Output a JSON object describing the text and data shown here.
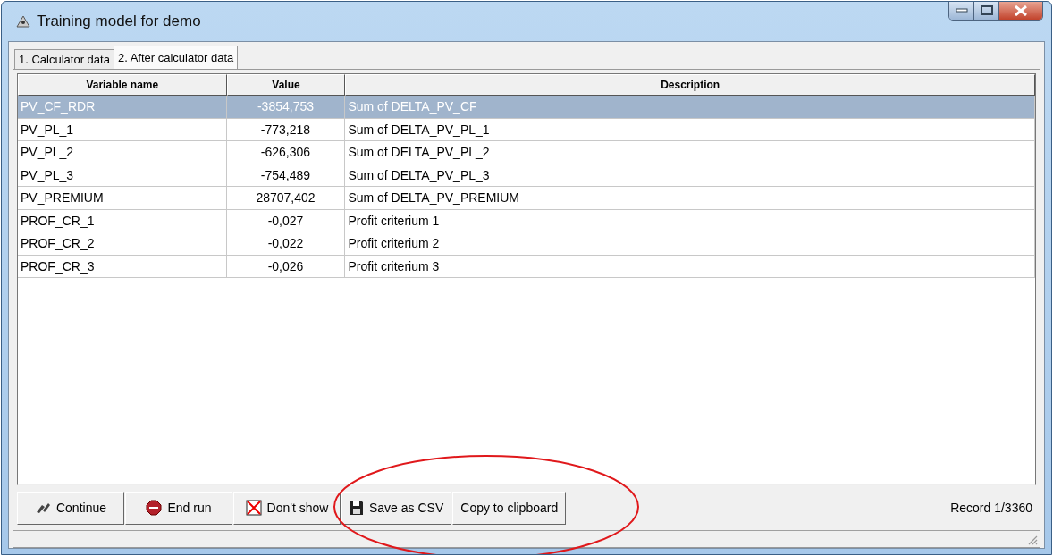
{
  "window": {
    "title": "Training model for demo"
  },
  "tabs": [
    {
      "label": "1. Calculator data",
      "selected": false
    },
    {
      "label": "2. After calculator data",
      "selected": true
    }
  ],
  "table": {
    "columns": [
      "Variable name",
      "Value",
      "Description"
    ],
    "rows": [
      {
        "cells": [
          "PV_CF_RDR",
          "-3854,753",
          "Sum of DELTA_PV_CF"
        ],
        "selected": true
      },
      {
        "cells": [
          "PV_PL_1",
          "-773,218",
          "Sum of DELTA_PV_PL_1"
        ],
        "selected": false
      },
      {
        "cells": [
          "PV_PL_2",
          "-626,306",
          "Sum of DELTA_PV_PL_2"
        ],
        "selected": false
      },
      {
        "cells": [
          "PV_PL_3",
          "-754,489",
          "Sum of DELTA_PV_PL_3"
        ],
        "selected": false
      },
      {
        "cells": [
          "PV_PREMIUM",
          "28707,402",
          "Sum of DELTA_PV_PREMIUM"
        ],
        "selected": false
      },
      {
        "cells": [
          "PROF_CR_1",
          "-0,027",
          "Profit criterium 1"
        ],
        "selected": false
      },
      {
        "cells": [
          "PROF_CR_2",
          "-0,022",
          "Profit criterium 2"
        ],
        "selected": false
      },
      {
        "cells": [
          "PROF_CR_3",
          "-0,026",
          "Profit criterium 3"
        ],
        "selected": false
      }
    ]
  },
  "buttons": [
    {
      "label": "Continue",
      "kind": "continue"
    },
    {
      "label": "End run",
      "kind": "stop"
    },
    {
      "label": "Don't show",
      "kind": "hide"
    },
    {
      "label": "Save as CSV",
      "kind": "save"
    },
    {
      "label": "Copy to clipboard",
      "kind": "plain"
    }
  ],
  "record": "Record 1/3360"
}
